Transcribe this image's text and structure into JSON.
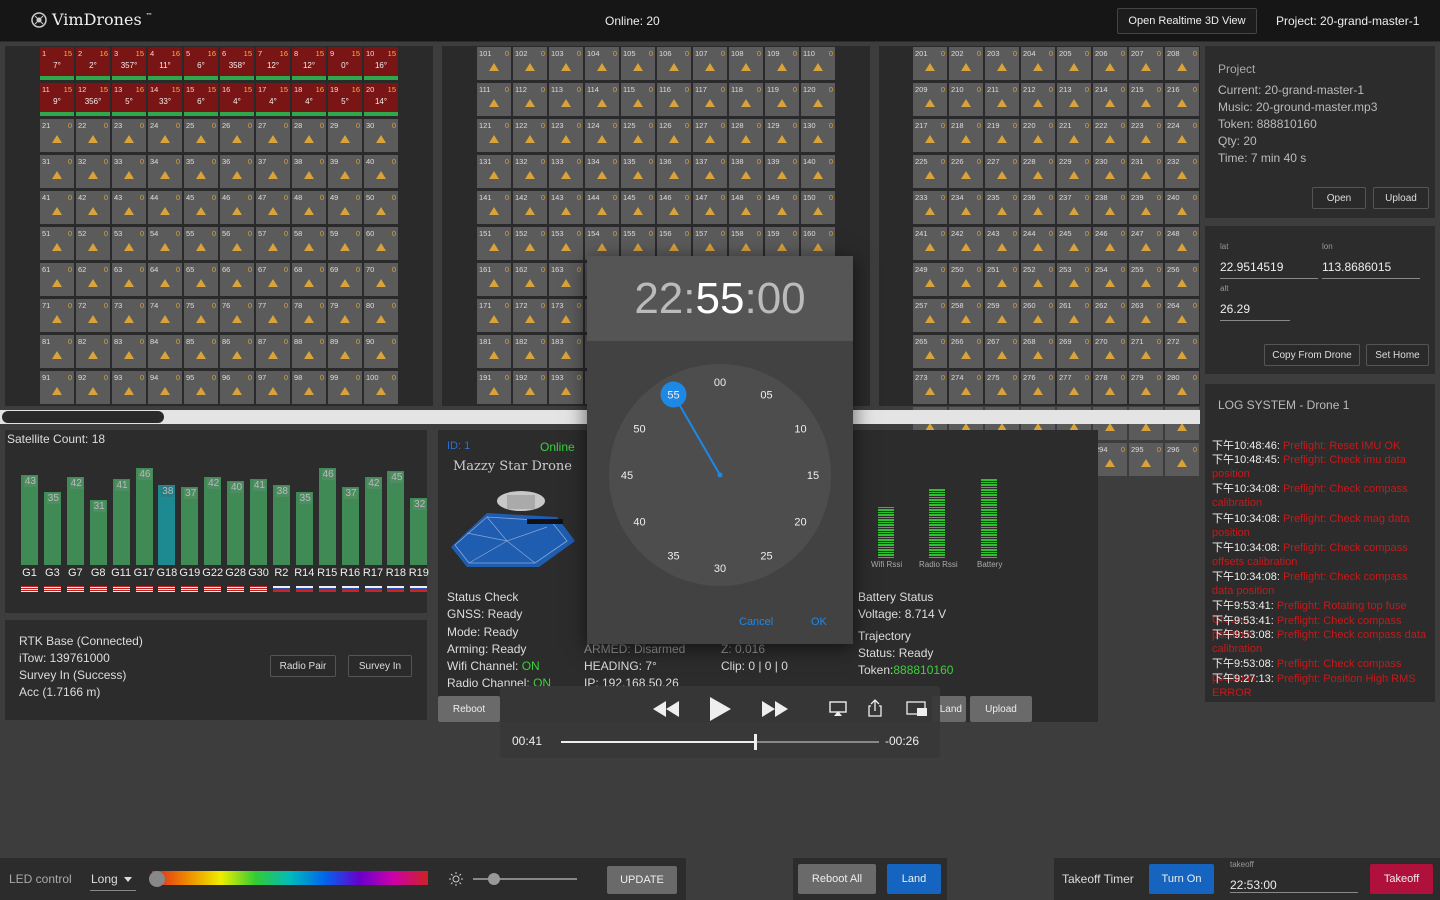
{
  "app": {
    "logo": "VimDrones",
    "tm": "™",
    "online": "Online: 20",
    "open_3d": "Open Realtime 3D View",
    "project_top": "Project: 20-grand-master-1"
  },
  "grid1": {
    "red_cells": [
      {
        "n": "1",
        "z": "15",
        "d": "7°"
      },
      {
        "n": "2",
        "z": "16",
        "d": "2°"
      },
      {
        "n": "3",
        "z": "15",
        "d": "357°"
      },
      {
        "n": "4",
        "z": "16",
        "d": "11°"
      },
      {
        "n": "5",
        "z": "16",
        "d": "6°"
      },
      {
        "n": "6",
        "z": "15",
        "d": "358°"
      },
      {
        "n": "7",
        "z": "16",
        "d": "12°"
      },
      {
        "n": "8",
        "z": "15",
        "d": "12°"
      },
      {
        "n": "9",
        "z": "15",
        "d": "0°"
      },
      {
        "n": "10",
        "z": "15",
        "d": "16°"
      },
      {
        "n": "11",
        "z": "15",
        "d": "9°"
      },
      {
        "n": "12",
        "z": "15",
        "d": "356°"
      },
      {
        "n": "13",
        "z": "16",
        "d": "5°"
      },
      {
        "n": "14",
        "z": "15",
        "d": "33°"
      },
      {
        "n": "15",
        "z": "15",
        "d": "6°"
      },
      {
        "n": "16",
        "z": "15",
        "d": "4°"
      },
      {
        "n": "17",
        "z": "15",
        "d": "4°"
      },
      {
        "n": "18",
        "z": "16",
        "d": "4°"
      },
      {
        "n": "19",
        "z": "16",
        "d": "5°"
      },
      {
        "n": "20",
        "z": "15",
        "d": "14°"
      }
    ],
    "grey_start": 21,
    "grey_end": 100
  },
  "grid2": {
    "start": 101,
    "end": 200
  },
  "grid3": {
    "start": 201,
    "end": 298
  },
  "satellite": {
    "title": "Satellite Count: 18",
    "bars": [
      {
        "label": "G1",
        "value": 43,
        "flag": "us"
      },
      {
        "label": "G3",
        "value": 35,
        "flag": "us"
      },
      {
        "label": "G7",
        "value": 42,
        "flag": "us"
      },
      {
        "label": "G8",
        "value": 31,
        "flag": "us"
      },
      {
        "label": "G11",
        "value": 41,
        "flag": "us"
      },
      {
        "label": "G17",
        "value": 46,
        "flag": "us"
      },
      {
        "label": "G18",
        "value": 38,
        "flag": "us",
        "teal": true
      },
      {
        "label": "G19",
        "value": 37,
        "flag": "us"
      },
      {
        "label": "G22",
        "value": 42,
        "flag": "us"
      },
      {
        "label": "G28",
        "value": 40,
        "flag": "us"
      },
      {
        "label": "G30",
        "value": 41,
        "flag": "us"
      },
      {
        "label": "R2",
        "value": 38,
        "flag": "ru"
      },
      {
        "label": "R14",
        "value": 35,
        "flag": "ru"
      },
      {
        "label": "R15",
        "value": 46,
        "flag": "ru"
      },
      {
        "label": "R16",
        "value": 37,
        "flag": "ru"
      },
      {
        "label": "R17",
        "value": 42,
        "flag": "ru"
      },
      {
        "label": "R18",
        "value": 45,
        "flag": "ru"
      },
      {
        "label": "R19",
        "value": 32,
        "flag": "ru"
      }
    ]
  },
  "rtk": {
    "line1": "RTK Base (Connected)",
    "line2": "iTow: 139761000",
    "line3": "Survey In (Success)",
    "line4": "Acc (1.7166 m)",
    "radio_pair": "Radio Pair",
    "survey_in": "Survey In"
  },
  "drone": {
    "id": "ID: 1",
    "online": "Online",
    "name": "Mazzy Star Drone",
    "status_check": "Status Check",
    "gnss": "GNSS: Ready",
    "mode": "Mode: Ready",
    "arming": "Arming: Ready",
    "wifi_label": "Wifi Channel: ",
    "wifi_val": "ON",
    "radio_label": "Radio Channel: ",
    "radio_val": "ON",
    "armed": "ARMED: Disarmed",
    "heading": "HEADING: 7°",
    "ip": "IP: 192.168.50.26",
    "z": "Z: 0.016",
    "clip": "Clip: 0 | 0 | 0",
    "battery_status": "Battery Status",
    "voltage": "Voltage: 8.714 V",
    "trajectory": "Trajectory",
    "traj_status": "Status: Ready",
    "token_label": "Token:",
    "token_val": "888810160",
    "wifi_rssi": "Wifi Rssi",
    "radio_rssi": "Radio Rssi",
    "battery": "Battery",
    "wifi_level": 0.62,
    "radio_level": 0.82,
    "battery_level": 0.94,
    "reboot": "Reboot",
    "land": "Land",
    "upload": "Upload"
  },
  "project": {
    "title": "Project",
    "current": "Current: 20-grand-master-1",
    "music": "Music: 20-ground-master.mp3",
    "token": "Token: 888810160",
    "qty": "Qty: 20",
    "time": "Time: 7 min 40 s",
    "open": "Open",
    "upload": "Upload"
  },
  "gps": {
    "lat_label": "lat",
    "lat": "22.9514519",
    "lon_label": "lon",
    "lon": "113.8686015",
    "alt_label": "alt",
    "alt": "26.29",
    "copy": "Copy From Drone",
    "set_home": "Set Home"
  },
  "log": {
    "title": "LOG SYSTEM - Drone 1",
    "entries": [
      {
        "t": "下午10:48:46:",
        "m": "Preflight: Reset IMU OK"
      },
      {
        "t": "下午10:48:45:",
        "m": "Preflight: Check imu data position"
      },
      {
        "t": "下午10:34:08:",
        "m": "Preflight: Check compass calibration"
      },
      {
        "t": "下午10:34:08:",
        "m": "Preflight: Check mag data position"
      },
      {
        "t": "下午10:34:08:",
        "m": "Preflight: Check compass offsets calibration"
      },
      {
        "t": "下午10:34:08:",
        "m": "Preflight: Check compass data position"
      },
      {
        "t": "下午9:53:41:",
        "m": "Preflight: Rotating top fuse Ground"
      },
      {
        "t": "下午9:53:41:",
        "m": "Preflight: Check compass position"
      },
      {
        "t": "下午9:53:08:",
        "m": "Preflight: Check compass data calibration"
      },
      {
        "t": "下午9:53:08:",
        "m": "Preflight: Check compass positions"
      },
      {
        "t": "下午9:27:13:",
        "m": "Preflight: Position High RMS ERROR"
      }
    ]
  },
  "timepicker": {
    "hh": "22",
    "mm": "55",
    "ss": "00",
    "sep": ":",
    "dial": [
      "00",
      "05",
      "10",
      "15",
      "20",
      "25",
      "30",
      "35",
      "40",
      "45",
      "50",
      "55"
    ],
    "cancel": "Cancel",
    "ok": "OK"
  },
  "video": {
    "elapsed": "00:41",
    "remaining": "-00:26",
    "progress": 0.61
  },
  "bottom": {
    "led_label": "LED control",
    "led_mode": "Long",
    "update": "UPDATE",
    "reboot_all": "Reboot All",
    "land": "Land",
    "takeoff_timer": "Takeoff Timer",
    "turn_on": "Turn On",
    "takeoff_field_label": "takeoff",
    "takeoff_time": "22:53:00",
    "takeoff": "Takeoff",
    "brightness": 0.2
  },
  "colors": {
    "accent_blue": "#1565c0",
    "crimson": "#b0103c",
    "online_green": "#3ecf3e",
    "log_red": "#c41a1a"
  }
}
